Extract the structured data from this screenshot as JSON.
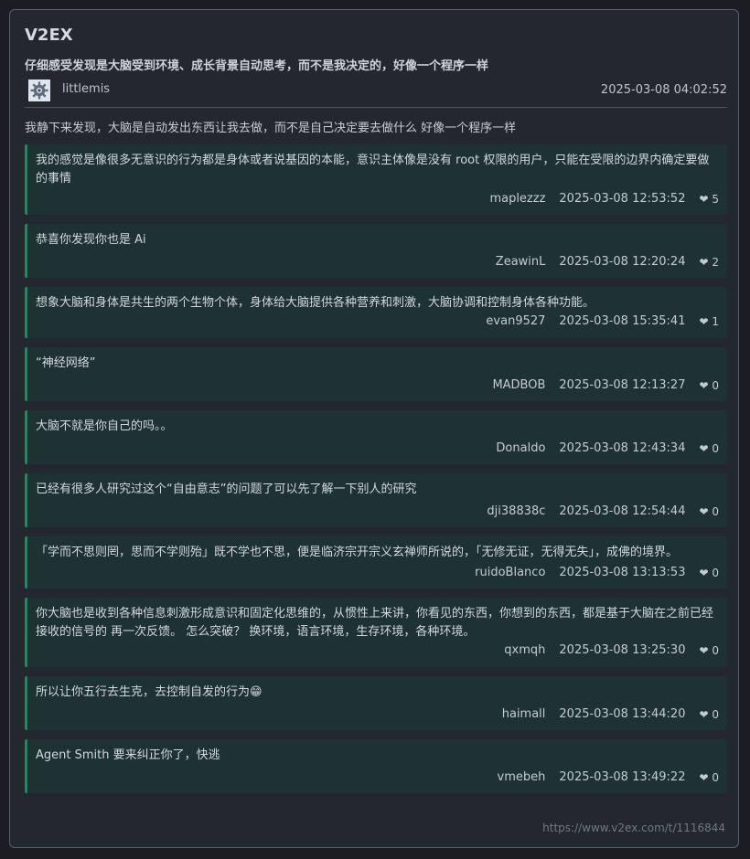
{
  "site": {
    "name": "V2EX"
  },
  "topic": {
    "title": "仔细感受发现是大脑受到环境、成长背景自动思考，而不是我决定的，好像一个程序一样",
    "author": "littlemis",
    "time": "2025-03-08 04:02:52",
    "body": "我静下来发现，大脑是自动发出东西让我去做，而不是自己决定要去做什么 好像一个程序一样"
  },
  "replies": [
    {
      "content": "我的感觉是像很多无意识的行为都是身体或者说基因的本能，意识主体像是没有 root 权限的用户，只能在受限的边界内确定要做的事情",
      "user": "maplezzz",
      "time": "2025-03-08 12:53:52",
      "likes": "❤ 5"
    },
    {
      "content": "恭喜你发现你也是 Ai",
      "user": "ZeawinL",
      "time": "2025-03-08 12:20:24",
      "likes": "❤ 2"
    },
    {
      "content": "想象大脑和身体是共生的两个生物个体，身体给大脑提供各种营养和刺激，大脑协调和控制身体各种功能。",
      "user": "evan9527",
      "time": "2025-03-08 15:35:41",
      "likes": "❤ 1"
    },
    {
      "content": "“神经网络”",
      "user": "MADBOB",
      "time": "2025-03-08 12:13:27",
      "likes": "❤ 0"
    },
    {
      "content": "大脑不就是你自己的吗。。",
      "user": "Donaldo",
      "time": "2025-03-08 12:43:34",
      "likes": "❤ 0"
    },
    {
      "content": "已经有很多人研究过这个“自由意志”的问题了可以先了解一下别人的研究",
      "user": "dji38838c",
      "time": "2025-03-08 12:54:44",
      "likes": "❤ 0"
    },
    {
      "content": "「学而不思则罔，思而不学则殆」既不学也不思，便是临济宗开宗义玄禅师所说的，「无修无证，无得无失」，成佛的境界。",
      "user": "ruidoBlanco",
      "time": "2025-03-08 13:13:53",
      "likes": "❤ 0"
    },
    {
      "content": "你大脑也是收到各种信息刺激形成意识和固定化思维的，从惯性上来讲，你看见的东西，你想到的东西，都是基于大脑在之前已经接收的信号的 再一次反馈。 怎么突破？ 换环境，语言环境，生存环境，各种环境。",
      "user": "qxmqh",
      "time": "2025-03-08 13:25:30",
      "likes": "❤ 0"
    },
    {
      "content": "所以让你五行去生克，去控制自发的行为😁",
      "user": "haimall",
      "time": "2025-03-08 13:44:20",
      "likes": "❤ 0"
    },
    {
      "content": "Agent Smith 要来纠正你了，快逃",
      "user": "vmebeh",
      "time": "2025-03-08 13:49:22",
      "likes": "❤ 0"
    }
  ],
  "footer": {
    "url": "https://www.v2ex.com/t/1116844"
  }
}
